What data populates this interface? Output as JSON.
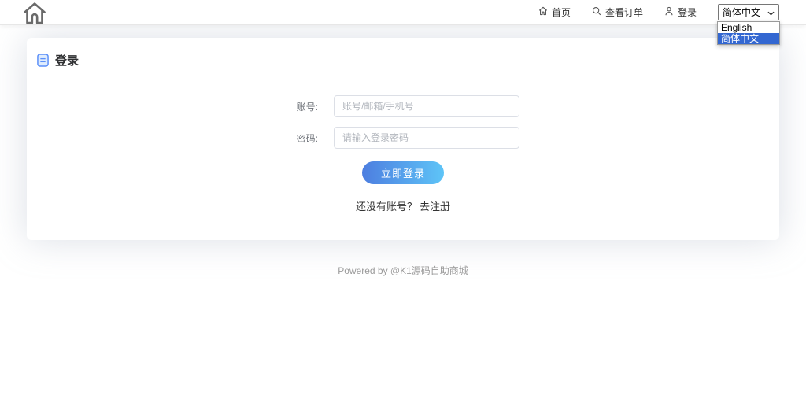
{
  "topbar": {
    "nav": [
      {
        "label": "首页"
      },
      {
        "label": "查看订单"
      },
      {
        "label": "登录"
      }
    ],
    "language_select": {
      "value": "简体中文",
      "options": [
        "English",
        "简体中文"
      ],
      "selected_option": "简体中文"
    }
  },
  "login_card": {
    "title": "登录",
    "fields": [
      {
        "label": "账号:",
        "placeholder": "账号/邮箱/手机号",
        "value": ""
      },
      {
        "label": "密码:",
        "placeholder": "请输入登录密码",
        "value": ""
      }
    ],
    "submit_label": "立即登录",
    "register_prompt": "还没有账号？",
    "register_link": "去注册"
  },
  "footer": {
    "text": "Powered by @K1源码自助商城"
  },
  "colors": {
    "button_gradient_start": "#4d7ee0",
    "button_gradient_end": "#5ec4f7",
    "dropdown_highlight": "#3367d1",
    "doc_icon_blue": "#5b8ff9",
    "input_border": "#dcdfe6",
    "topbar_border": "#e7e7e7"
  }
}
